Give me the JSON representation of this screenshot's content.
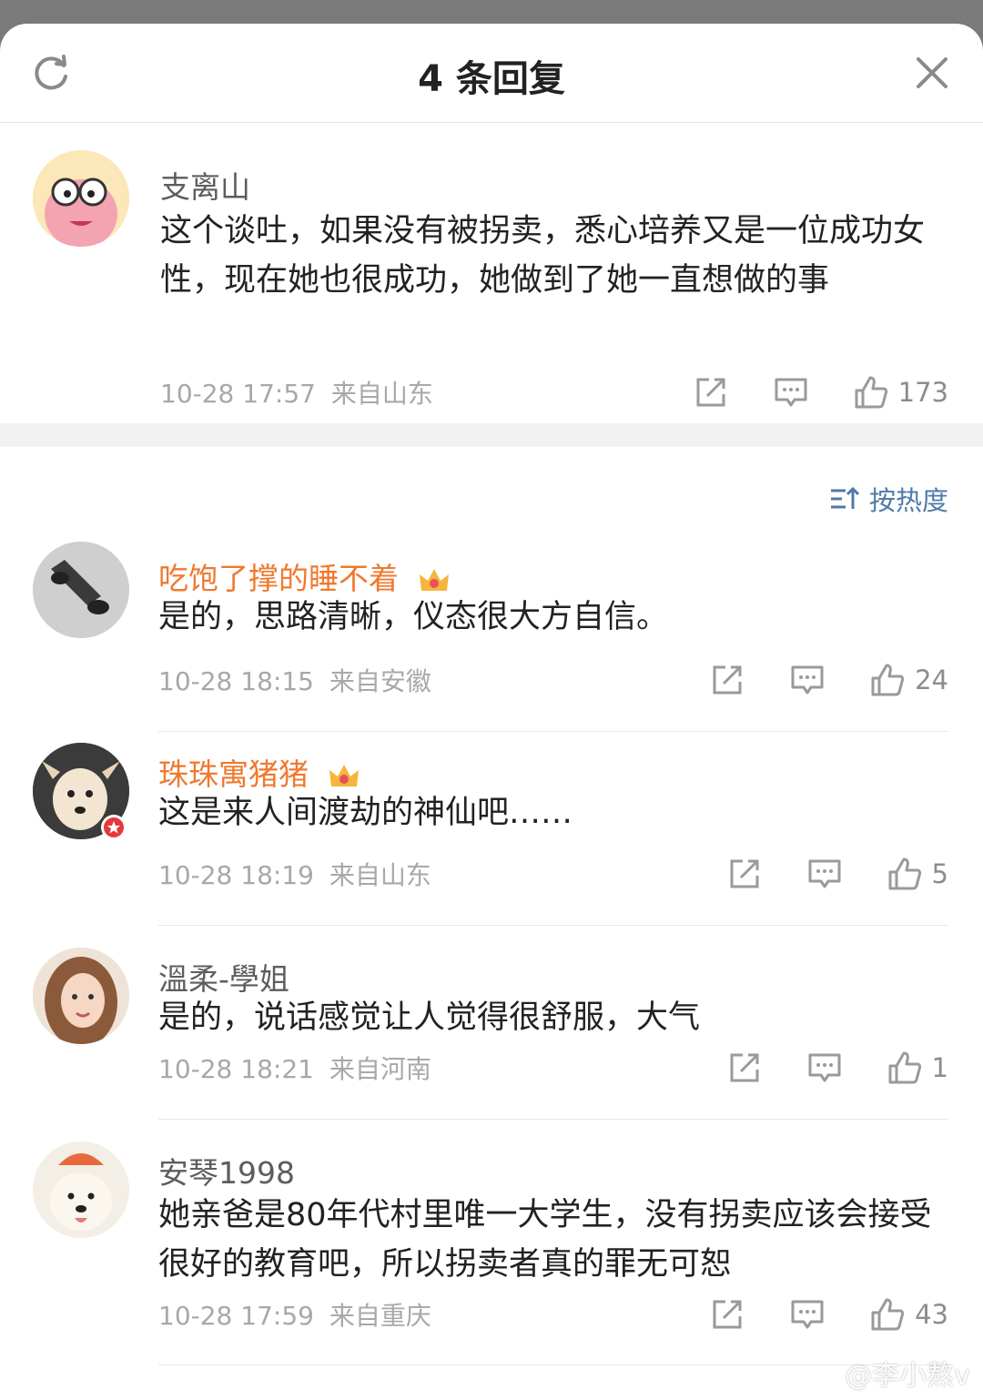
{
  "header": {
    "title": "4 条回复"
  },
  "root": {
    "name": "支离山",
    "text": "这个谈吐，如果没有被拐卖，悉心培养又是一位成功女性，现在她也很成功，她做到了她一直想做的事",
    "time": "10-28 17:57",
    "location": "来自山东",
    "likes": "173"
  },
  "sort": {
    "label": "按热度"
  },
  "replies": [
    {
      "name": "吃饱了撑的睡不着",
      "text": "是的，思路清晰，仪态很大方自信。",
      "time": "10-28 18:15",
      "location": "来自安徽",
      "likes": "24"
    },
    {
      "name": "珠珠寓猪猪",
      "text": "这是来人间渡劫的神仙吧……",
      "time": "10-28 18:19",
      "location": "来自山东",
      "likes": "5"
    },
    {
      "name": "溫柔-學姐",
      "text": "是的，说话感觉让人觉得很舒服，大气",
      "time": "10-28 18:21",
      "location": "来自河南",
      "likes": "1"
    },
    {
      "name": "安琴1998",
      "text": "她亲爸是80年代村里唯一大学生，没有拐卖应该会接受很好的教育吧，所以拐卖者真的罪无可恕",
      "time": "10-28 17:59",
      "location": "来自重庆",
      "likes": "43"
    }
  ],
  "watermark": "@李小熬v",
  "colors": {
    "accent_blue": "#4f79a8",
    "vip_orange": "#f0792f"
  }
}
